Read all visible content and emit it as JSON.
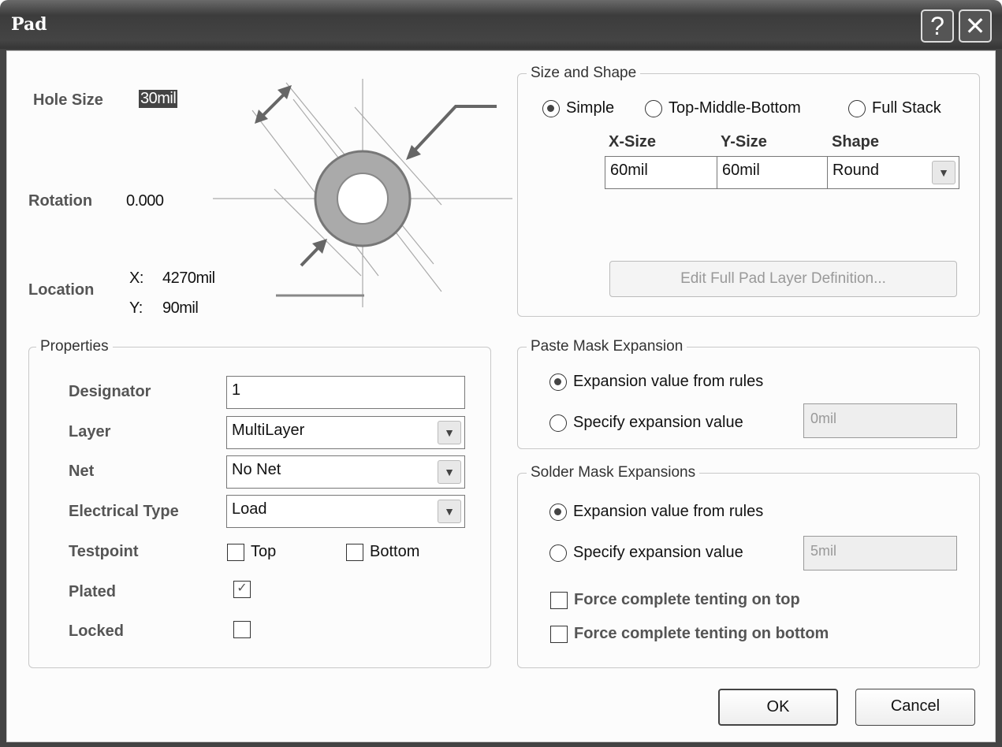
{
  "window": {
    "title": "Pad",
    "help_icon": "?",
    "close_icon": "✕"
  },
  "top": {
    "hole_size_label": "Hole Size",
    "hole_size_value": "30mil",
    "rotation_label": "Rotation",
    "rotation_value": "0.000",
    "location_label": "Location",
    "x_label": "X:",
    "x_value": "4270mil",
    "y_label": "Y:",
    "y_value": "90mil"
  },
  "size_shape": {
    "legend": "Size and Shape",
    "modes": [
      {
        "label": "Simple",
        "selected": true
      },
      {
        "label": "Top-Middle-Bottom",
        "selected": false
      },
      {
        "label": "Full Stack",
        "selected": false
      }
    ],
    "columns": [
      "X-Size",
      "Y-Size",
      "Shape"
    ],
    "x_size": "60mil",
    "y_size": "60mil",
    "shape": "Round",
    "edit_button": "Edit Full Pad Layer Definition..."
  },
  "properties": {
    "legend": "Properties",
    "designator_label": "Designator",
    "designator_value": "1",
    "layer_label": "Layer",
    "layer_value": "MultiLayer",
    "net_label": "Net",
    "net_value": "No Net",
    "electrical_label": "Electrical Type",
    "electrical_value": "Load",
    "testpoint_label": "Testpoint",
    "testpoint_top": "Top",
    "testpoint_bottom": "Bottom",
    "plated_label": "Plated",
    "locked_label": "Locked"
  },
  "paste_mask": {
    "legend": "Paste Mask Expansion",
    "from_rules": "Expansion value from rules",
    "specify": "Specify expansion value",
    "value": "0mil"
  },
  "solder_mask": {
    "legend": "Solder Mask Expansions",
    "from_rules": "Expansion value from rules",
    "specify": "Specify expansion value",
    "value": "5mil",
    "tent_top": "Force complete tenting on top",
    "tent_bottom": "Force complete tenting on bottom"
  },
  "buttons": {
    "ok": "OK",
    "cancel": "Cancel"
  }
}
